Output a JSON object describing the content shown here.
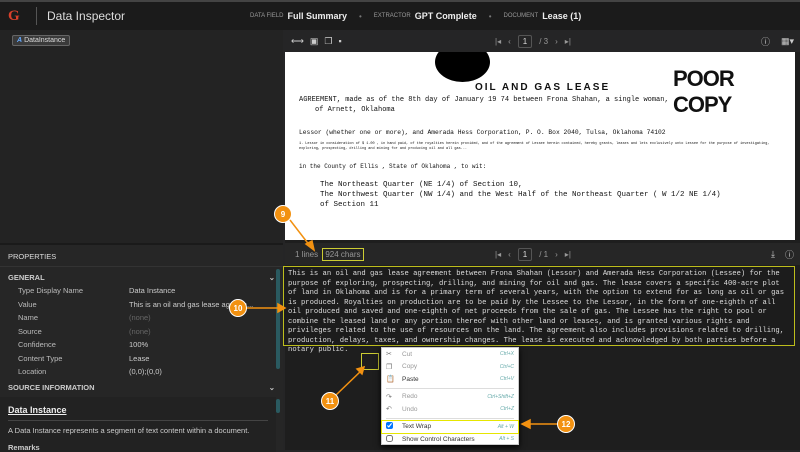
{
  "header": {
    "logo": "G",
    "title": "Data Inspector",
    "fields": [
      {
        "label": "DATA FIELD",
        "value": "Full Summary"
      },
      {
        "label": "EXTRACTOR",
        "value": "GPT Complete"
      },
      {
        "label": "DOCUMENT",
        "value": "Lease (1)"
      }
    ]
  },
  "left": {
    "chip": "DataInstance"
  },
  "properties": {
    "title": "PROPERTIES",
    "general": "GENERAL",
    "rows": [
      {
        "name": "Type Display Name",
        "value": "Data Instance"
      },
      {
        "name": "Value",
        "value": "This is an oil and gas lease agreem..."
      },
      {
        "name": "Name",
        "value": "(none)"
      },
      {
        "name": "Source",
        "value": "(none)"
      },
      {
        "name": "Confidence",
        "value": "100%"
      },
      {
        "name": "Content Type",
        "value": "Lease"
      },
      {
        "name": "Location",
        "value": "(0,0);(0,0)"
      }
    ],
    "source_info": "SOURCE INFORMATION",
    "help_title": "Data Instance",
    "help_text": "A Data Instance represents a segment of text content within a document.",
    "remarks": "Remarks"
  },
  "viewer": {
    "page": "1",
    "total": "/ 3",
    "doc": {
      "stamp": "POOR COPY",
      "title": "OIL AND GAS LEASE",
      "line1": "AGREEMENT, made as of the 8th day of January 19 74 between Frona Shahan, a single woman,",
      "line2": "of Arnett, Oklahoma",
      "line3": "Lessor (whether one or more), and Amerada Hess Corporation, P. O. Box 2040, Tulsa, Oklahoma 74102",
      "line4": "1. Lessor in consideration of $ 1.00 , in hand paid, of the royalties herein provided, and of the agreement of Lessee herein contained, hereby grants, leases and lets exclusively unto Lessee for the purpose of investigating, exploring, prospecting, drilling and mining for and producing oil and all gas...",
      "line5": "in the County of Ellis , State of Oklahoma , to wit:",
      "legal": [
        "The Northeast Quarter (NE 1/4) of Section 10,",
        "The Northwest Quarter (NW 1/4) and the West Half of the Northeast Quarter ( W 1/2 NE 1/4)",
        "of Section 11"
      ]
    }
  },
  "text_panel": {
    "lines": "1 lines",
    "chars": "924 chars",
    "page": "1",
    "total": "/ 1",
    "content": "This is an oil and gas lease agreement between Frona Shahan (Lessor) and Amerada Hess Corporation (Lessee) for the purpose of exploring, prospecting, drilling, and mining for oil and gas. The lease covers a specific 400-acre plot of land in Oklahoma and is for a primary term of several years, with the option to extend for as long as oil or gas is produced. Royalties on production are to be paid by the Lessee to the Lessor, in the form of one-eighth of all oil produced and saved and one-eighth of net proceeds from the sale of gas. The Lessee has the right to pool or combine the leased land or any portion thereof with other land or leases, and is granted various rights and privileges related to the use of resources on the land. The agreement also includes provisions related to drilling, production, delays, taxes, and ownership changes. The lease is executed and acknowledged by both parties before a notary public."
  },
  "context_menu": [
    {
      "label": "Cut",
      "shortcut": "Ctrl+X",
      "icon": "scissors-icon",
      "enabled": false
    },
    {
      "label": "Copy",
      "shortcut": "Ctrl+C",
      "icon": "copy-icon",
      "enabled": false
    },
    {
      "label": "Paste",
      "shortcut": "Ctrl+V",
      "icon": "paste-icon",
      "enabled": true
    },
    {
      "label": "Redo",
      "shortcut": "Ctrl+Shift+Z",
      "icon": "redo-icon",
      "enabled": false
    },
    {
      "label": "Undo",
      "shortcut": "Ctrl+Z",
      "icon": "undo-icon",
      "enabled": false
    },
    {
      "label": "Text Wrap",
      "shortcut": "Alt + W",
      "checked": true
    },
    {
      "label": "Show Control Characters",
      "shortcut": "Alt + S",
      "checked": false
    }
  ],
  "annotations": [
    "9",
    "10",
    "11",
    "12"
  ],
  "colors": {
    "highlight": "#e6e600",
    "badge": "#f29111"
  }
}
